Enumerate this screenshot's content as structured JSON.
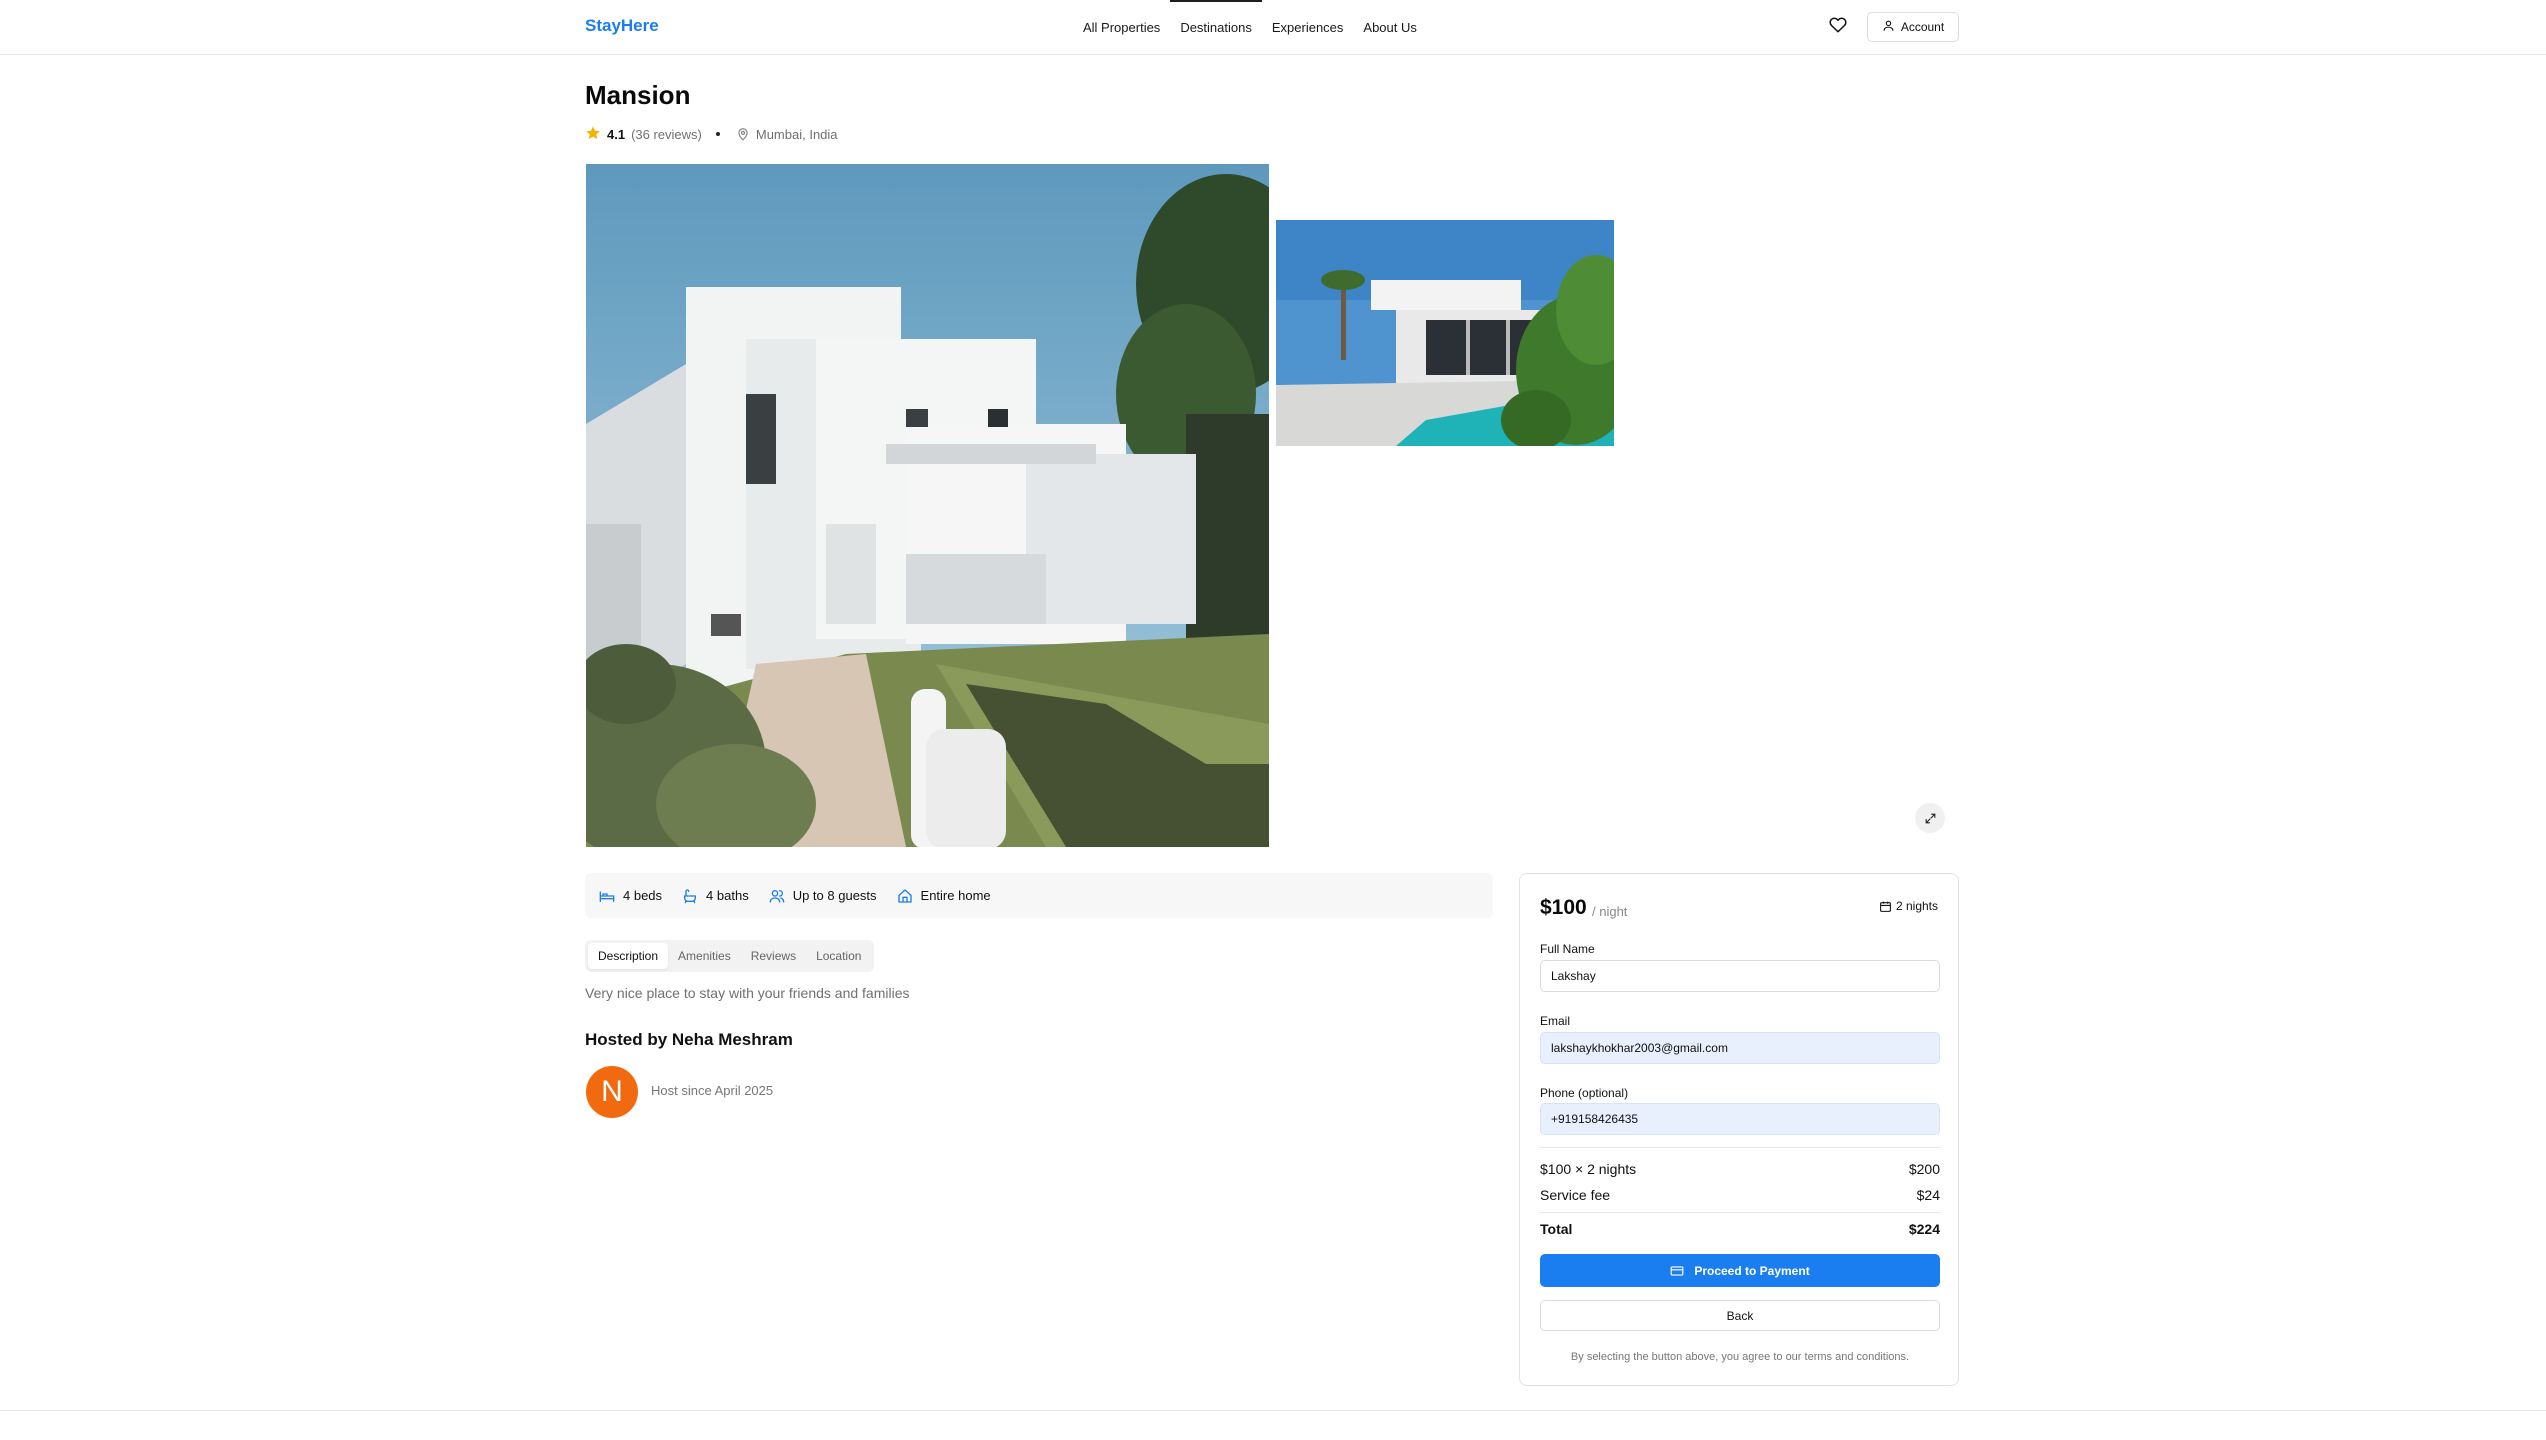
{
  "header": {
    "logo": "StayHere",
    "nav": [
      "All Properties",
      "Destinations",
      "Experiences",
      "About Us"
    ],
    "active_nav": "Destinations",
    "account_label": "Account"
  },
  "property": {
    "title": "Mansion",
    "rating": "4.1",
    "reviews": "(36 reviews)",
    "location": "Mumbai, India",
    "features": {
      "beds": "4 beds",
      "baths": "4 baths",
      "guests": "Up to 8 guests",
      "type": "Entire home"
    },
    "tabs": [
      "Description",
      "Amenities",
      "Reviews",
      "Location"
    ],
    "active_tab": "Description",
    "description": "Very nice place to stay with your friends and families",
    "host_title": "Hosted by Neha Meshram",
    "host_initial": "N",
    "host_since": "Host since April 2025"
  },
  "booking": {
    "price": "$100",
    "per_night": "/ night",
    "nights": "2 nights",
    "full_name_label": "Full Name",
    "full_name_value": "Lakshay",
    "email_label": "Email",
    "email_value": "lakshaykhokhar2003@gmail.com",
    "phone_label": "Phone (optional)",
    "phone_value": "+919158426435",
    "line_label": "$100 × 2 nights",
    "line_value": "$200",
    "fee_label": "Service fee",
    "fee_value": "$24",
    "total_label": "Total",
    "total_value": "$224",
    "pay_label": "Proceed to Payment",
    "back_label": "Back",
    "terms": "By selecting the button above, you agree to our terms and conditions."
  },
  "colors": {
    "brand": "#1a7df0",
    "avatar": "#f26a0f",
    "star": "#f5b301"
  }
}
